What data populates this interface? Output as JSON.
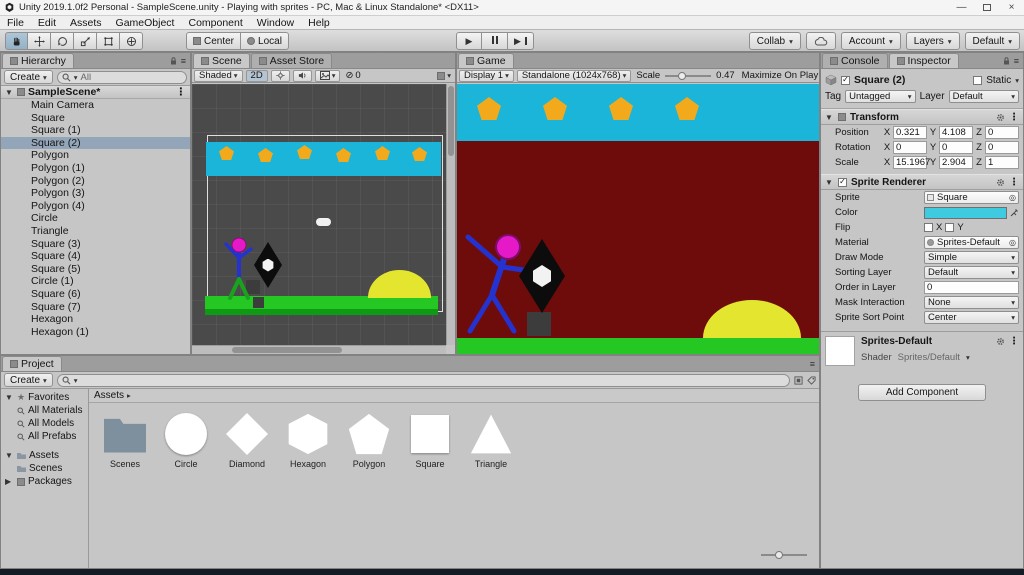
{
  "window": {
    "title": "Unity 2019.1.0f2 Personal - SampleScene.unity - Playing with sprites - PC, Mac & Linux Standalone* <DX11>",
    "minimize": "—",
    "close": "×"
  },
  "menubar": [
    "File",
    "Edit",
    "Assets",
    "GameObject",
    "Component",
    "Window",
    "Help"
  ],
  "icons": {
    "chevron_down": "▾",
    "foldout_open": "▼",
    "foldout_closed": "▶",
    "check": "✓",
    "star": "★",
    "menu": "≡",
    "more": "⋮",
    "picker": "◎",
    "slash": "⊘",
    "play": "▶",
    "breadcrumb_arrow": "▸"
  },
  "toolbar": {
    "pivot": "Center",
    "space": "Local",
    "collab": "Collab",
    "account": "Account",
    "layers": "Layers",
    "layout": "Default"
  },
  "hierarchy": {
    "tab": "Hierarchy",
    "create": "Create",
    "search_filter": "All",
    "scene_name": "SampleScene*",
    "items": [
      {
        "label": "Main Camera"
      },
      {
        "label": "Square"
      },
      {
        "label": "Square (1)"
      },
      {
        "label": "Square (2)",
        "selected": true
      },
      {
        "label": "Polygon"
      },
      {
        "label": "Polygon (1)"
      },
      {
        "label": "Polygon (2)"
      },
      {
        "label": "Polygon (3)"
      },
      {
        "label": "Polygon (4)"
      },
      {
        "label": "Circle"
      },
      {
        "label": "Triangle"
      },
      {
        "label": "Square (3)"
      },
      {
        "label": "Square (4)"
      },
      {
        "label": "Square (5)"
      },
      {
        "label": "Circle (1)"
      },
      {
        "label": "Square (6)"
      },
      {
        "label": "Square (7)"
      },
      {
        "label": "Hexagon"
      },
      {
        "label": "Hexagon (1)"
      }
    ]
  },
  "scene_view": {
    "tab": "Scene",
    "tab_asset_store": "Asset Store",
    "shading": "Shaded",
    "mode_2d": "2D",
    "hidden_count": "0"
  },
  "game_view": {
    "tab": "Game",
    "display": "Display 1",
    "resolution": "Standalone (1024x768)",
    "scale_label": "Scale",
    "scale_value": "0.47",
    "maximize_on_play": "Maximize On Play"
  },
  "inspector": {
    "tab_console": "Console",
    "tab": "Inspector",
    "object_name": "Square (2)",
    "static_label": "Static",
    "tag_label": "Tag",
    "tag_value": "Untagged",
    "layer_label": "Layer",
    "layer_value": "Default",
    "transform": {
      "title": "Transform",
      "rows": [
        {
          "label": "Position",
          "ax": "X",
          "x": "0.321",
          "ay": "Y",
          "y": "4.108",
          "az": "Z",
          "z": "0"
        },
        {
          "label": "Rotation",
          "ax": "X",
          "x": "0",
          "ay": "Y",
          "y": "0",
          "az": "Z",
          "z": "0"
        },
        {
          "label": "Scale",
          "ax": "X",
          "x": "15.1967",
          "ay": "Y",
          "y": "2.904",
          "az": "Z",
          "z": "1"
        }
      ]
    },
    "sprite_renderer": {
      "title": "Sprite Renderer",
      "sprite_label": "Sprite",
      "sprite_value": "Square",
      "color_label": "Color",
      "flip_label": "Flip",
      "flip_x": "X",
      "flip_y": "Y",
      "material_label": "Material",
      "material_value": "Sprites-Default",
      "draw_mode_label": "Draw Mode",
      "draw_mode_value": "Simple",
      "sorting_layer_label": "Sorting Layer",
      "sorting_layer_value": "Default",
      "order_label": "Order in Layer",
      "order_value": "0",
      "mask_label": "Mask Interaction",
      "mask_value": "None",
      "sort_point_label": "Sprite Sort Point",
      "sort_point_value": "Center"
    },
    "material_preview": {
      "name": "Sprites-Default",
      "shader_label": "Shader",
      "shader_value": "Sprites/Default"
    },
    "add_component": "Add Component"
  },
  "project": {
    "tab": "Project",
    "create": "Create",
    "favorites_label": "Favorites",
    "favorites": [
      {
        "label": "All Materials"
      },
      {
        "label": "All Models"
      },
      {
        "label": "All Prefabs"
      }
    ],
    "assets_label": "Assets",
    "assets_children": [
      {
        "label": "Scenes"
      }
    ],
    "packages_label": "Packages",
    "breadcrumb": "Assets",
    "items": [
      {
        "label": "Scenes",
        "shape": "folder"
      },
      {
        "label": "Circle",
        "shape": "circle"
      },
      {
        "label": "Diamond",
        "shape": "diamond"
      },
      {
        "label": "Hexagon",
        "shape": "hexagon"
      },
      {
        "label": "Polygon",
        "shape": "pentagon"
      },
      {
        "label": "Square",
        "shape": "square"
      },
      {
        "label": "Triangle",
        "shape": "triangle"
      }
    ]
  },
  "scene_colors": {
    "sky": "#1ab5d8",
    "ground": "#25c822",
    "ground_dark": "#0e9a14",
    "maroon": "#6e0b0b",
    "sun": "#e3e52f",
    "pentagon": "#f2a91c",
    "head": "#e619c9",
    "body": "#2433d0",
    "legs": "#1aa21e",
    "viewport": "#4a4a4a",
    "swatch": "#3ecadf"
  }
}
